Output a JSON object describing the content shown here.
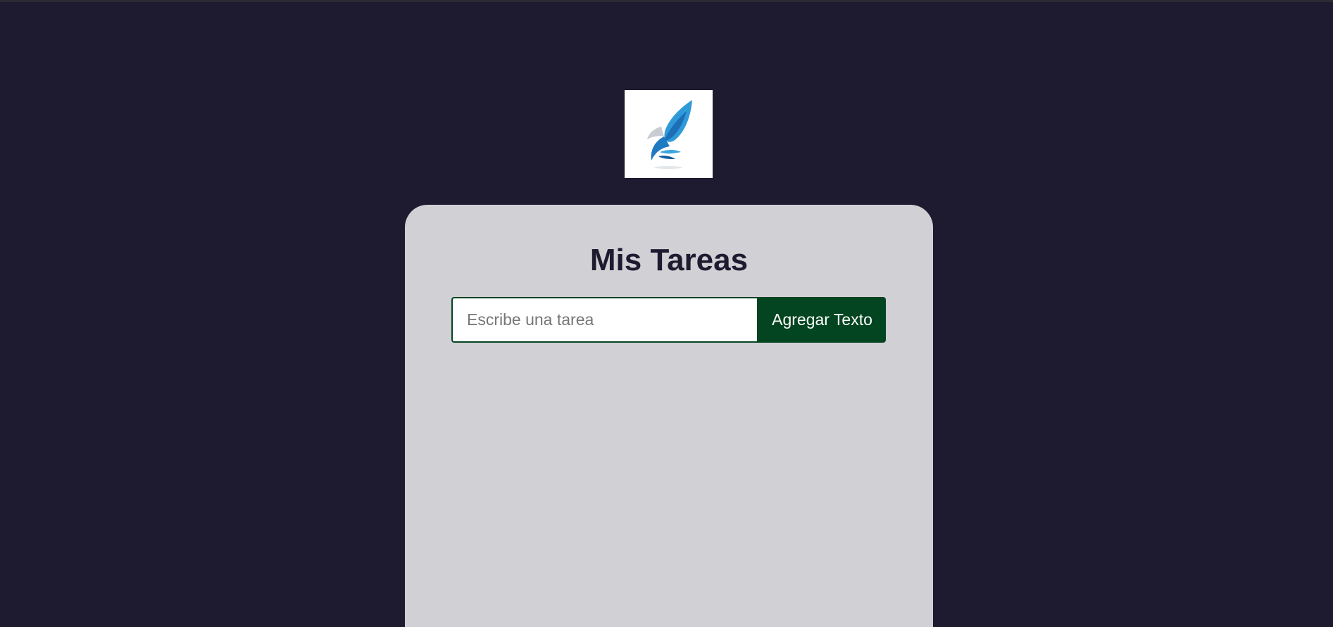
{
  "app": {
    "title": "Mis Tareas",
    "logo_icon": "bird-wing-logo-icon"
  },
  "task_form": {
    "input_value": "",
    "input_placeholder": "Escribe una tarea",
    "add_button_label": "Agregar Texto"
  },
  "task_list": [],
  "colors": {
    "page_background": "#1e1b30",
    "card_background": "#d1d0d5",
    "title_text": "#1e1b30",
    "accent_green": "#034520",
    "logo_blue": "#2f8fd0"
  }
}
